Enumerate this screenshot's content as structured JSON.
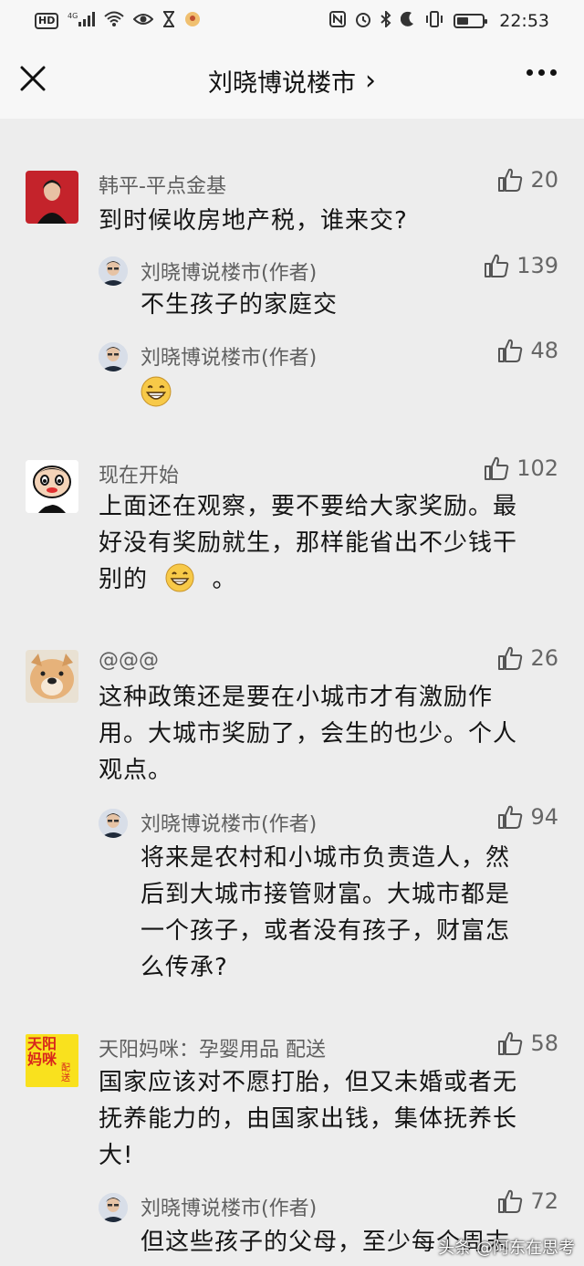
{
  "status_bar": {
    "network": "4G",
    "time": "22:53",
    "hd": "HD"
  },
  "header": {
    "title": "刘晓博说楼市",
    "chevron": "›"
  },
  "comments": [
    {
      "name": "韩平-平点金基",
      "text": "到时候收房地产税，谁来交?",
      "likes": "20",
      "replies": [
        {
          "name": "刘晓博说楼市(作者)",
          "text": "不生孩子的家庭交",
          "likes": "139"
        },
        {
          "name": "刘晓博说楼市(作者)",
          "text": "",
          "emoji": "grinning-emoji",
          "likes": "48"
        }
      ]
    },
    {
      "name": "现在开始",
      "text_lines": [
        "上面还在观察，要不要给大家奖励。最",
        "好没有奖励就生，那样能省出不少钱干",
        "别的"
      ],
      "text_tail": "。",
      "likes": "102"
    },
    {
      "name": "@@@",
      "text_lines": [
        "这种政策还是要在小城市才有激励作",
        "用。大城市奖励了，会生的也少。个人",
        "观点。"
      ],
      "likes": "26",
      "replies": [
        {
          "name": "刘晓博说楼市(作者)",
          "text_lines": [
            "将来是农村和小城市负责造人，然",
            "后到大城市接管财富。大城市都是",
            "一个孩子，或者没有孩子，财富怎",
            "么传承?"
          ],
          "likes": "94"
        }
      ]
    },
    {
      "name": "天阳妈咪：孕婴用品 配送",
      "avatar_text": "天阳妈咪",
      "avatar_sub": "配送",
      "text_lines": [
        "国家应该对不愿打胎，但又未婚或者无",
        "抚养能力的，由国家出钱，集体抚养长",
        "大!"
      ],
      "likes": "58",
      "replies": [
        {
          "name": "刘晓博说楼市(作者)",
          "text": "但这些孩子的父母，至少每个周末",
          "likes": "72"
        }
      ]
    }
  ],
  "watermark": "头条 @阿东在思考",
  "colors": {
    "background": "#ededed",
    "header_bg": "#f7f7f7",
    "name": "#5f5f5f",
    "text": "#151515"
  }
}
